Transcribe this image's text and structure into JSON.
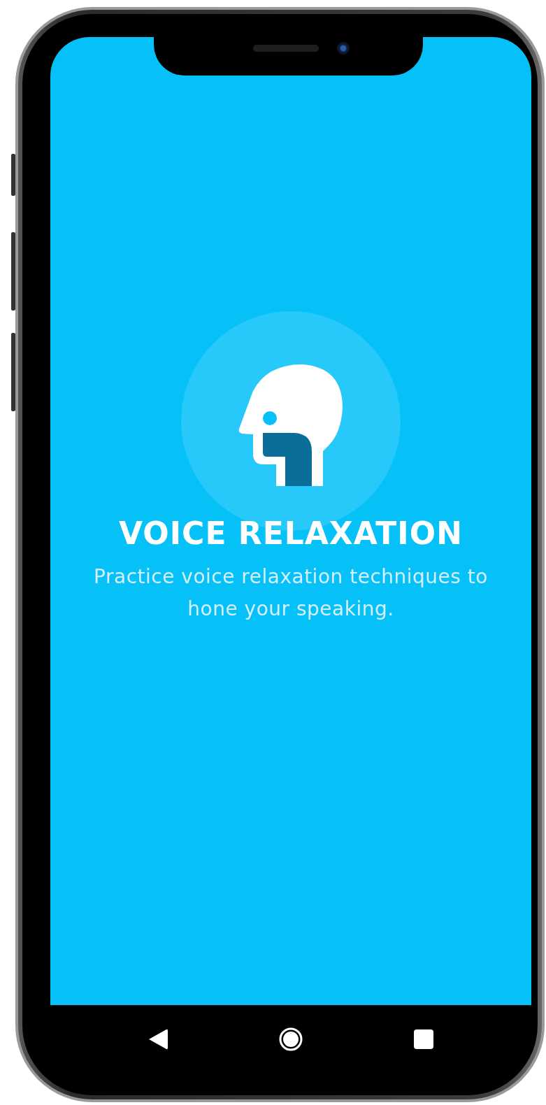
{
  "screen": {
    "title": "VOICE RELAXATION",
    "subtitle": "Practice voice relaxation techniques to hone your speaking."
  },
  "nav_bar": {
    "buttons": [
      {
        "kind": "back"
      },
      {
        "kind": "home"
      },
      {
        "kind": "recents"
      }
    ]
  }
}
